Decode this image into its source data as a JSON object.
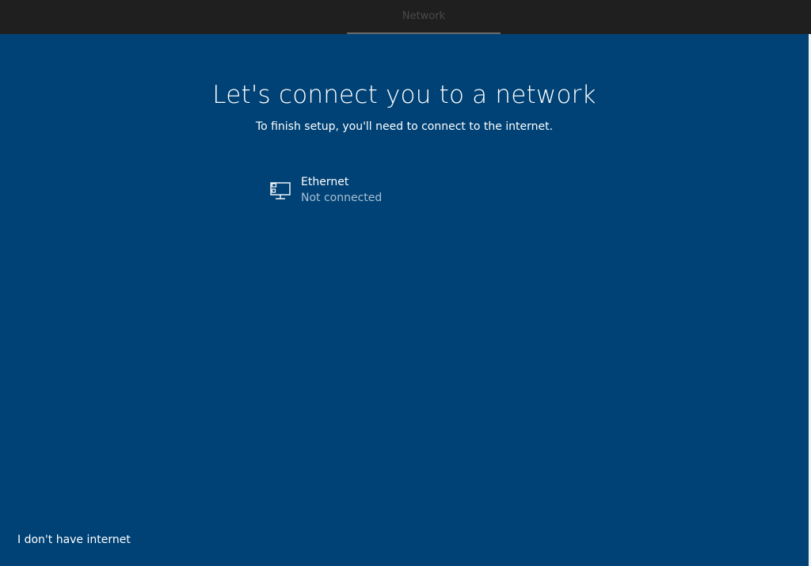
{
  "header": {
    "tab_label": "Network"
  },
  "main": {
    "title": "Let's connect you to a network",
    "subtitle": "To finish setup, you'll need to connect to the internet.",
    "networks": [
      {
        "icon": "ethernet-icon",
        "name": "Ethernet",
        "status": "Not connected"
      }
    ]
  },
  "footer": {
    "no_internet_label": "I don't have internet"
  },
  "colors": {
    "background": "#004275",
    "topbar": "#1f1f1f",
    "text": "#ffffff",
    "status_text": "#a9bfd4"
  }
}
